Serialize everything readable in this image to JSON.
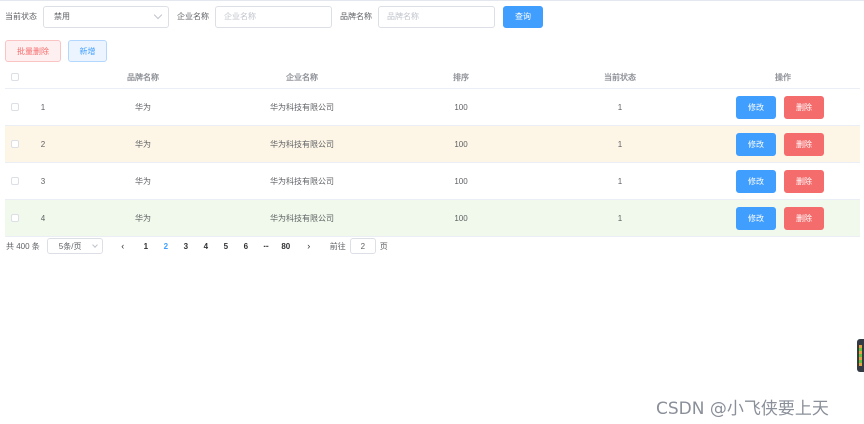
{
  "search": {
    "status_label": "当前状态",
    "status_value": "禁用",
    "company_label": "企业名称",
    "company_placeholder": "企业名称",
    "brand_label": "品牌名称",
    "brand_placeholder": "品牌名称",
    "query_button": "查询"
  },
  "actions": {
    "batch_delete": "批量删除",
    "add": "新增"
  },
  "table": {
    "headers": {
      "brand": "品牌名称",
      "company": "企业名称",
      "sort": "排序",
      "status": "当前状态",
      "ops": "操作"
    },
    "rows": [
      {
        "index": "1",
        "brand": "华为",
        "company": "华为科技有限公司",
        "sort": "100",
        "status": "1",
        "edit": "修改",
        "delete": "删除"
      },
      {
        "index": "2",
        "brand": "华为",
        "company": "华为科技有限公司",
        "sort": "100",
        "status": "1",
        "edit": "修改",
        "delete": "删除"
      },
      {
        "index": "3",
        "brand": "华为",
        "company": "华为科技有限公司",
        "sort": "100",
        "status": "1",
        "edit": "修改",
        "delete": "删除"
      },
      {
        "index": "4",
        "brand": "华为",
        "company": "华为科技有限公司",
        "sort": "100",
        "status": "1",
        "edit": "修改",
        "delete": "删除"
      }
    ]
  },
  "pagination": {
    "total": "共 400 条",
    "page_size": "5条/页",
    "prev_icon": "chevron-left-icon",
    "next_icon": "chevron-right-icon",
    "pages": [
      "1",
      "2",
      "3",
      "4",
      "5",
      "6"
    ],
    "current_page": "2",
    "ellipsis": "···",
    "last_page": "80",
    "goto_label": "前往",
    "goto_value": "2",
    "goto_suffix": "页"
  },
  "watermark": "CSDN @小飞侠要上天",
  "colors": {
    "primary": "#409eff",
    "danger": "#f56c6c",
    "warning_row": "#fdf5e6",
    "success_row": "#f0f9eb"
  }
}
